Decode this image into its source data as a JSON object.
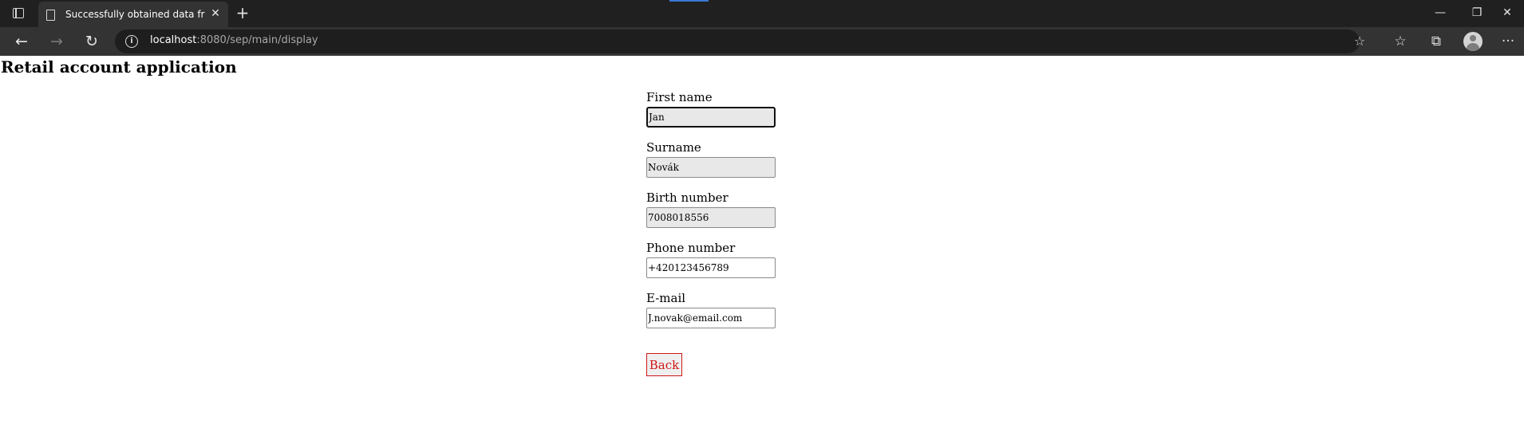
{
  "browser": {
    "tab": {
      "title": "Successfully obtained data from",
      "page_icon": "page-icon",
      "close_glyph": "✕"
    },
    "new_tab_glyph": "+",
    "window_controls": {
      "minimize": "—",
      "restore": "❐",
      "close": "✕"
    },
    "nav": {
      "back": "←",
      "forward": "→",
      "reload": "↻"
    },
    "address": {
      "host": "localhost",
      "rest": ":8080/sep/main/display"
    },
    "toolbar_icons": [
      "add-favorite-icon",
      "favorites-icon",
      "collections-icon",
      "profile-icon",
      "more-icon"
    ],
    "toolbar_glyphs": {
      "add_favorite": "☆",
      "favorites": "☆",
      "collections": "⧉",
      "more": "···"
    }
  },
  "page": {
    "title": "Retail account application",
    "fields": [
      {
        "label": "First name",
        "value": "Jan",
        "readonly": true,
        "focused": true
      },
      {
        "label": "Surname",
        "value": "Novák",
        "readonly": true
      },
      {
        "label": "Birth number",
        "value": "7008018556",
        "readonly": true
      },
      {
        "label": "Phone number",
        "value": "+420123456789",
        "readonly": false
      },
      {
        "label": "E-mail",
        "value": "J.novak@email.com",
        "readonly": false
      }
    ],
    "back_button": "Back"
  },
  "colors": {
    "chrome_dark": "#202020",
    "toolbar": "#333333",
    "accent": "#3b78d4",
    "button_red": "#d01818",
    "readonly_bg": "#e8e8e8"
  }
}
